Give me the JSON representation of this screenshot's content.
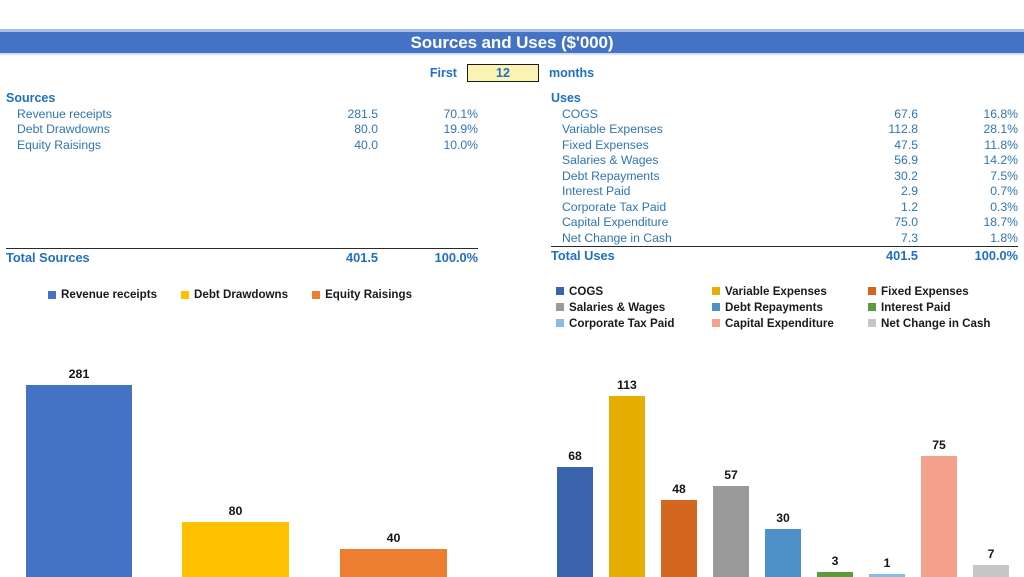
{
  "header": {
    "title": "Sources and Uses ($'000)",
    "banner_color": "#4472C4"
  },
  "period": {
    "prefix_label": "First",
    "value": "12",
    "suffix_label": "months"
  },
  "sources_table": {
    "heading": "Sources",
    "rows": [
      {
        "name": "Revenue receipts",
        "value": "281.5",
        "percent": "70.1%"
      },
      {
        "name": "Debt Drawdowns",
        "value": "80.0",
        "percent": "19.9%"
      },
      {
        "name": "Equity Raisings",
        "value": "40.0",
        "percent": "10.0%"
      }
    ],
    "total": {
      "name": "Total Sources",
      "value": "401.5",
      "percent": "100.0%"
    }
  },
  "uses_table": {
    "heading": "Uses",
    "rows": [
      {
        "name": "COGS",
        "value": "67.6",
        "percent": "16.8%"
      },
      {
        "name": "Variable Expenses",
        "value": "112.8",
        "percent": "28.1%"
      },
      {
        "name": "Fixed Expenses",
        "value": "47.5",
        "percent": "11.8%"
      },
      {
        "name": "Salaries & Wages",
        "value": "56.9",
        "percent": "14.2%"
      },
      {
        "name": "Debt Repayments",
        "value": "30.2",
        "percent": "7.5%"
      },
      {
        "name": "Interest Paid",
        "value": "2.9",
        "percent": "0.7%"
      },
      {
        "name": "Corporate Tax Paid",
        "value": "1.2",
        "percent": "0.3%"
      },
      {
        "name": "Capital Expenditure",
        "value": "75.0",
        "percent": "18.7%"
      },
      {
        "name": "Net Change in Cash",
        "value": "7.3",
        "percent": "1.8%"
      }
    ],
    "total": {
      "name": "Total Uses",
      "value": "401.5",
      "percent": "100.0%"
    }
  },
  "chart_data": [
    {
      "id": "sources-chart",
      "type": "bar",
      "title": "",
      "xlabel": "",
      "ylabel": "",
      "grid": false,
      "legend_position": "top",
      "ylim": [
        0,
        320
      ],
      "categories": [
        "Revenue receipts",
        "Debt Drawdowns",
        "Equity Raisings"
      ],
      "values": [
        281,
        80,
        40
      ],
      "data_labels": [
        "281",
        "80",
        "40"
      ],
      "legend": [
        "Revenue receipts",
        "Debt Drawdowns",
        "Equity Raisings"
      ],
      "colors": [
        "#4472C4",
        "#FFC000",
        "#ED7D31"
      ]
    },
    {
      "id": "uses-chart",
      "type": "bar",
      "title": "",
      "xlabel": "",
      "ylabel": "",
      "grid": false,
      "legend_position": "top",
      "ylim": [
        0,
        125
      ],
      "categories": [
        "COGS",
        "Variable Expenses",
        "Fixed Expenses",
        "Salaries & Wages",
        "Debt Repayments",
        "Interest Paid",
        "Corporate Tax Paid",
        "Capital Expenditure",
        "Net Change in Cash"
      ],
      "values": [
        68,
        113,
        48,
        57,
        30,
        3,
        1,
        75,
        7
      ],
      "data_labels": [
        "68",
        "113",
        "48",
        "57",
        "30",
        "3",
        "1",
        "75",
        "7"
      ],
      "legend": [
        "COGS",
        "Variable Expenses",
        "Fixed Expenses",
        "Salaries & Wages",
        "Debt Repayments",
        "Interest Paid",
        "Corporate Tax Paid",
        "Capital Expenditure",
        "Net Change in Cash"
      ],
      "colors": [
        "#3A63AE",
        "#E5AE00",
        "#D4661F",
        "#9A9A9A",
        "#4E91C8",
        "#5E9B3F",
        "#8CBBE0",
        "#F4A28B",
        "#C6C6C6"
      ]
    }
  ]
}
